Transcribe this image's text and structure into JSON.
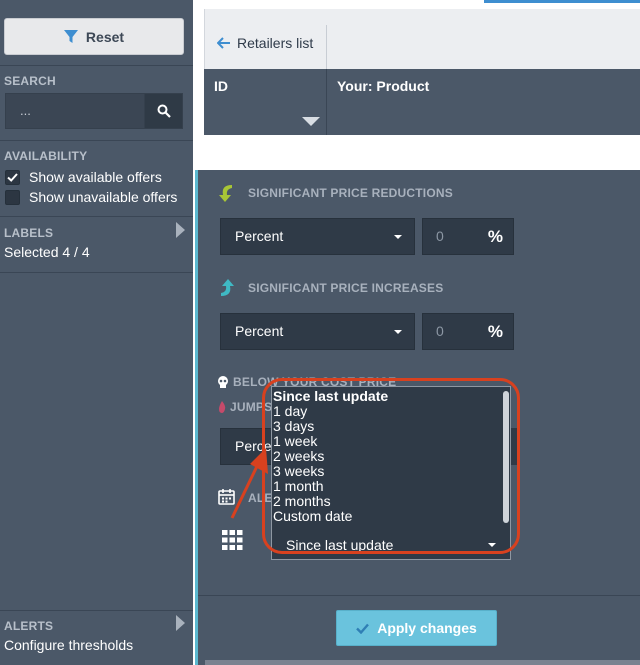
{
  "sidebar": {
    "reset_label": "Reset",
    "search": {
      "heading": "SEARCH",
      "placeholder": "..."
    },
    "availability": {
      "heading": "AVAILABILITY",
      "options": [
        {
          "label": "Show available offers",
          "checked": true
        },
        {
          "label": "Show unavailable offers",
          "checked": false
        }
      ]
    },
    "labels": {
      "heading": "LABELS",
      "value": "Selected 4 / 4"
    },
    "alerts": {
      "heading": "ALERTS",
      "value": "Configure thresholds"
    }
  },
  "topbar": {
    "back_label": "Retailers list"
  },
  "table": {
    "col_id": "ID",
    "col_product": "Your: Product"
  },
  "panel": {
    "reductions": {
      "heading": "SIGNIFICANT PRICE REDUCTIONS",
      "mode": "Percent",
      "value": "0",
      "unit": "%"
    },
    "increases": {
      "heading": "SIGNIFICANT PRICE INCREASES",
      "mode": "Percent",
      "value": "0",
      "unit": "%"
    },
    "below_cost": {
      "heading": "BELOW YOUR COST PRICE"
    },
    "jumps": {
      "heading": "JUMPS",
      "mode_partial": "Perce"
    },
    "alert_partial": "ALE",
    "period": {
      "options": [
        "Since last update",
        "1 day",
        "3 days",
        "1 week",
        "2 weeks",
        "3 weeks",
        "1 month",
        "2 months",
        "Custom date"
      ],
      "selected": "Since last update"
    },
    "apply_label": "Apply changes"
  },
  "colors": {
    "accent": "#6ac3dd",
    "annotation": "#d8411f",
    "panel": "#4b5868"
  }
}
